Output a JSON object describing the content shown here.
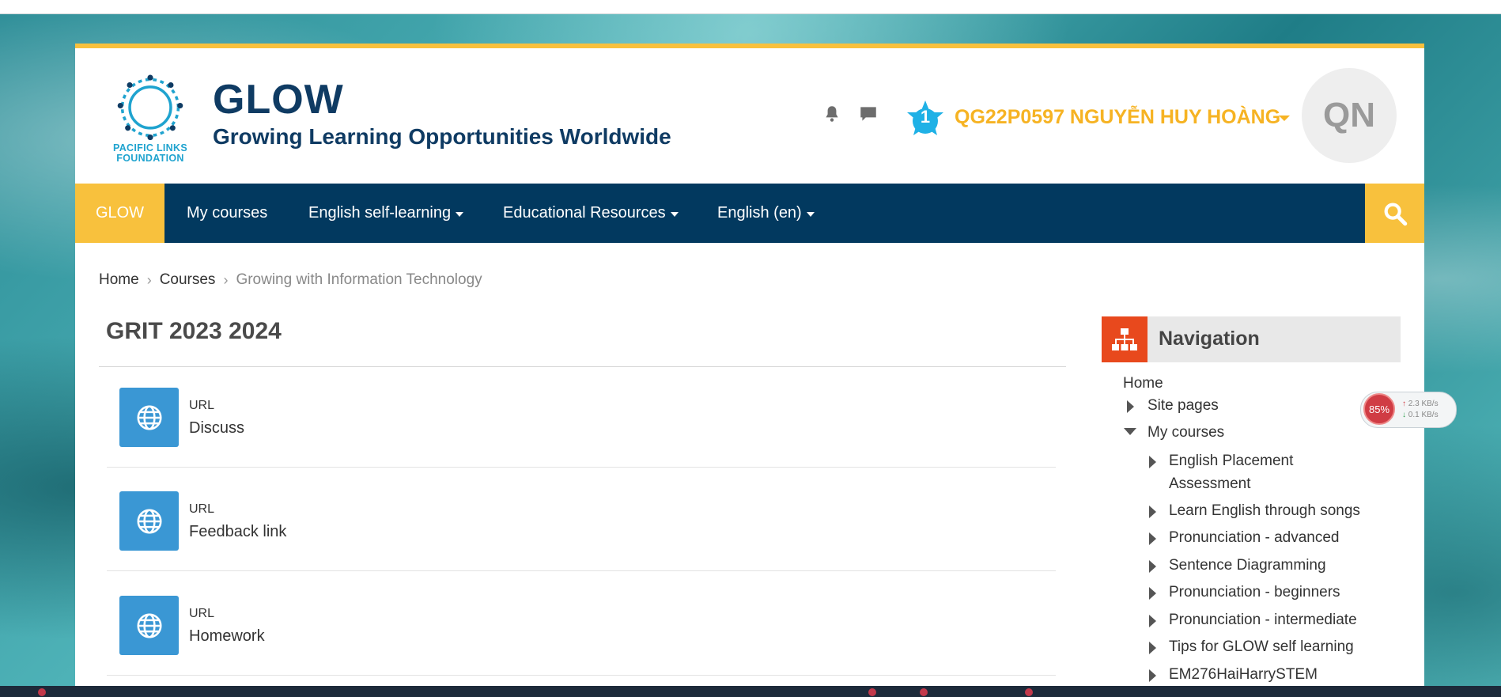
{
  "header": {
    "logo_text": "PACIFIC LINKS FOUNDATION",
    "title": "GLOW",
    "subtitle": "Growing Learning Opportunities Worldwide",
    "notification_icon": "bell-icon",
    "messages_icon": "chat-icon",
    "badge_number": "1",
    "username": "QG22P0597 NGUYỄN HUY HOÀNG",
    "avatar_initials": "QN"
  },
  "navbar": {
    "items": [
      {
        "label": "GLOW",
        "active": true
      },
      {
        "label": "My courses"
      },
      {
        "label": "English self-learning",
        "dropdown": true
      },
      {
        "label": "Educational Resources",
        "dropdown": true
      },
      {
        "label": "English (en)",
        "dropdown": true
      }
    ],
    "search_icon": "search-icon"
  },
  "breadcrumb": [
    "Home",
    "Courses",
    "Growing with Information Technology"
  ],
  "section": {
    "title": "GRIT 2023 2024",
    "activities": [
      {
        "type": "URL",
        "name": "Discuss",
        "icon": "globe-icon"
      },
      {
        "type": "URL",
        "name": "Feedback link",
        "icon": "globe-icon"
      },
      {
        "type": "URL",
        "name": "Homework",
        "icon": "globe-icon"
      }
    ]
  },
  "navigation": {
    "title": "Navigation",
    "icon": "sitemap-icon",
    "home": "Home",
    "site_pages": "Site pages",
    "my_courses": "My courses",
    "courses": [
      "English Placement",
      "Assessment",
      "Learn English through songs",
      "Pronunciation - advanced",
      "Sentence Diagramming",
      "Pronunciation - beginners",
      "Pronunciation - intermediate",
      "Tips for GLOW self learning",
      "EM276HaiHarrySTEM"
    ]
  },
  "speed_widget": {
    "percent": "85%",
    "upload": "2.3 KB/s",
    "download": "0.1 KB/s"
  },
  "colors": {
    "accent": "#f8c13d",
    "navbar": "#02395f",
    "brand": "#0f3b63",
    "activity_icon": "#3a97d4",
    "nav_icon": "#e8491d",
    "username": "#f6b323"
  }
}
